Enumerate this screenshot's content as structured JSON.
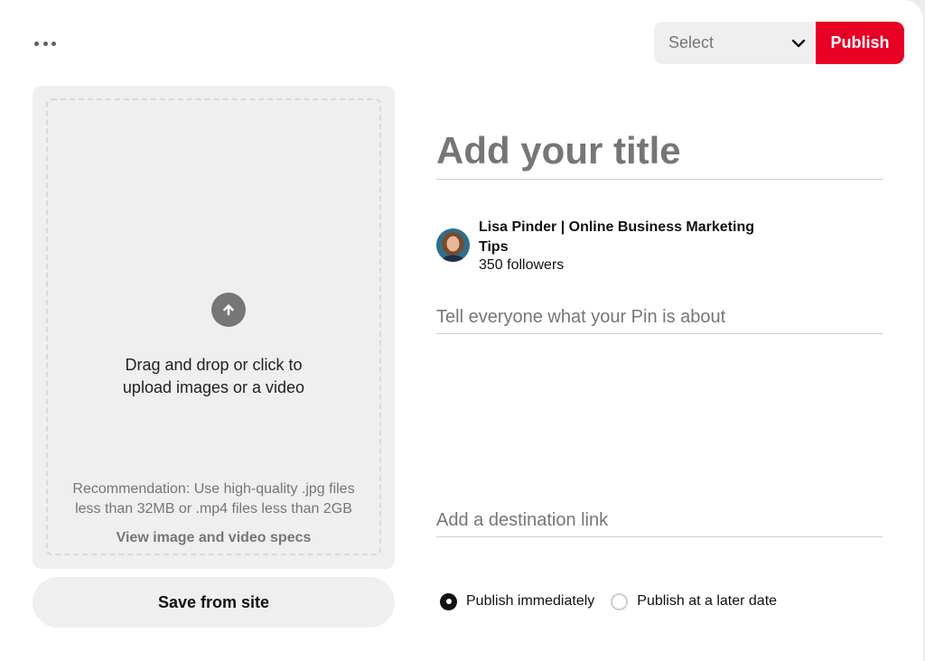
{
  "header": {
    "more_icon": "more-horizontal-icon",
    "board_select": {
      "value": "Select",
      "icon": "chevron-down-icon"
    },
    "publish_label": "Publish"
  },
  "upload": {
    "icon": "arrow-up-circle-icon",
    "drop_text": "Drag and drop or click to upload images or a video",
    "recommendation": "Recommendation: Use high-quality .jpg files less than 32MB or .mp4 files less than 2GB",
    "specs_link": "View image and video specs",
    "save_from_site": "Save from site"
  },
  "form": {
    "title_placeholder": "Add your title",
    "profile": {
      "name": "Lisa Pinder | Online Business Marketing Tips",
      "followers": "350 followers"
    },
    "description_placeholder": "Tell everyone what your Pin is about",
    "link_placeholder": "Add a destination link",
    "publish_options": [
      {
        "label": "Publish immediately",
        "checked": true
      },
      {
        "label": "Publish at a later date",
        "checked": false
      }
    ]
  },
  "colors": {
    "brand_red": "#e60023",
    "panel_gray": "#efefef",
    "text_muted": "#767676"
  }
}
